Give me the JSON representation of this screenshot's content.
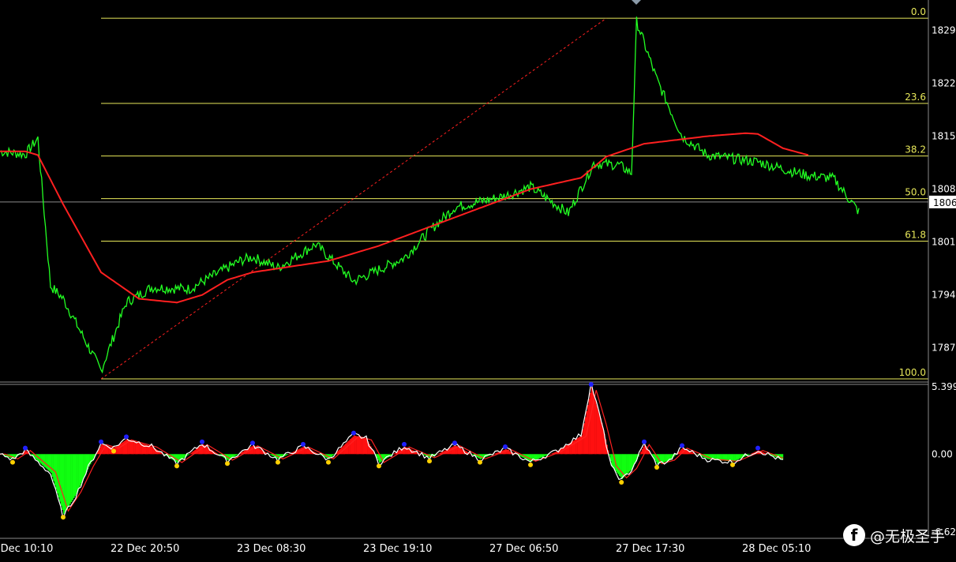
{
  "chart_data": [
    {
      "type": "line",
      "title": "",
      "colors": {
        "price": "#22ff22",
        "ma": "#ff2020",
        "fib": "#e8e85a",
        "trend": "#ff2020",
        "background": "#000000",
        "axis_text": "#ffffff"
      },
      "price_axis": {
        "ylim": [
          1782.9,
          1832.6
        ],
        "tick_labels": [
          "1829",
          "1822",
          "1815",
          "1808",
          "1801",
          "1794",
          "1787"
        ],
        "tick_values": [
          1829,
          1822,
          1815,
          1808,
          1801,
          1794,
          1787
        ],
        "current_price_label": "1806",
        "current_price": 1806.3
      },
      "fibonacci": {
        "high": 1830.6,
        "low": 1782.9,
        "levels": [
          {
            "label": "0.0",
            "ratio": 0.0
          },
          {
            "label": "23.6",
            "ratio": 0.236
          },
          {
            "label": "38.2",
            "ratio": 0.382
          },
          {
            "label": "50.0",
            "ratio": 0.5
          },
          {
            "label": "61.8",
            "ratio": 0.618
          },
          {
            "label": "100.0",
            "ratio": 1.0
          }
        ]
      },
      "time_axis": {
        "labels": [
          "22 Dec 10:10",
          "22 Dec 20:50",
          "23 Dec 08:30",
          "23 Dec 19:10",
          "27 Dec 06:50",
          "27 Dec 17:30",
          "28 Dec 05:10"
        ],
        "label_index": [
          0,
          50,
          100,
          150,
          200,
          250,
          300
        ],
        "bar_count": 315
      },
      "series": [
        {
          "name": "",
          "x": [
            0,
            10,
            15,
            20,
            25,
            40,
            50,
            60,
            75,
            95,
            100,
            110,
            125,
            140,
            160,
            170,
            180,
            200,
            210,
            225,
            235,
            245,
            250,
            252,
            260,
            270,
            280,
            300,
            315,
            320,
            330,
            340
          ],
          "values": [
            1813.0,
            1812.6,
            1814.7,
            1795.2,
            1793.5,
            1784.0,
            1793.0,
            1795.0,
            1794.8,
            1798.5,
            1799.0,
            1797.6,
            1800.7,
            1795.8,
            1798.9,
            1802.5,
            1805.6,
            1807.1,
            1808.3,
            1804.8,
            1811.4,
            1811.2,
            1810.1,
            1830.2,
            1822.5,
            1815.0,
            1812.5,
            1811.6,
            1810.2,
            1809.8,
            1809.4,
            1805.0
          ]
        },
        {
          "name": "",
          "x": [
            0,
            10,
            15,
            25,
            40,
            55,
            70,
            80,
            90,
            100,
            130,
            150,
            170,
            190,
            210,
            230,
            240,
            255,
            280,
            295,
            300,
            310,
            320
          ],
          "values": [
            1813.0,
            1813.0,
            1812.5,
            1806.0,
            1797.0,
            1793.5,
            1793.0,
            1794.0,
            1796.0,
            1797.0,
            1798.5,
            1800.5,
            1803.0,
            1805.5,
            1808.0,
            1809.5,
            1812.3,
            1814.0,
            1815.0,
            1815.4,
            1815.3,
            1813.4,
            1812.5
          ]
        }
      ],
      "trendline": {
        "from": {
          "x": 40,
          "y": 1782.9
        },
        "to": {
          "x": 240,
          "y": 1830.6
        }
      }
    },
    {
      "type": "area",
      "title": "",
      "ylim": [
        -6.62,
        5.399
      ],
      "tick_labels": [
        "5.399",
        "0.00",
        "-6.62"
      ],
      "tick_values": [
        5.399,
        0.0,
        -6.62
      ],
      "colors": {
        "positive": "#ff1010",
        "negative": "#10ff10",
        "signal_fast": "#ffffff",
        "signal_slow": "#ff2020",
        "marker_high": "#2020ff",
        "marker_low": "#ffd000"
      },
      "series": [
        {
          "name": "",
          "x": [
            0,
            5,
            10,
            15,
            20,
            25,
            30,
            35,
            40,
            45,
            50,
            60,
            70,
            80,
            90,
            100,
            110,
            120,
            130,
            140,
            145,
            150,
            160,
            170,
            180,
            190,
            200,
            210,
            220,
            230,
            234,
            238,
            242,
            246,
            250,
            255,
            260,
            265,
            270,
            280,
            290,
            300,
            310
          ],
          "values": [
            0.0,
            -0.4,
            0.3,
            -0.6,
            -1.5,
            -4.8,
            -3.2,
            -1.0,
            0.8,
            0.5,
            1.2,
            0.6,
            -0.7,
            0.8,
            -0.5,
            0.7,
            -0.4,
            0.6,
            -0.4,
            1.5,
            1.2,
            -0.7,
            0.6,
            -0.3,
            0.7,
            -0.4,
            0.4,
            -0.6,
            0.2,
            1.5,
            5.4,
            2.5,
            -1.0,
            -2.0,
            -1.2,
            0.8,
            -0.8,
            -0.5,
            0.5,
            -0.4,
            -0.6,
            0.3,
            -0.5
          ]
        }
      ]
    }
  ],
  "watermark": {
    "logo_glyph": "f",
    "text": "@无极圣手"
  }
}
